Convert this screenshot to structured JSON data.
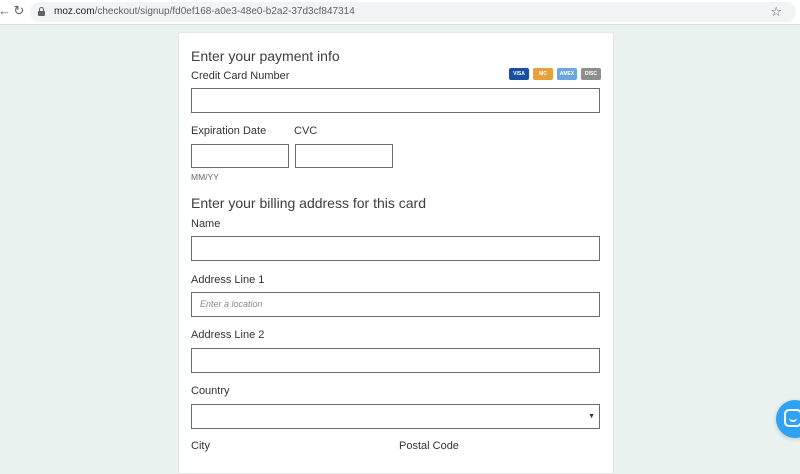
{
  "browser": {
    "url_host": "moz.com",
    "url_path": "/checkout/signup/fd0ef168-a0e3-48e0-b2a2-37d3cf847314",
    "back_icon": "arrow-back-icon",
    "reload_icon": "reload-icon",
    "lock_icon": "lock-icon",
    "bookmark_icon": "star-icon"
  },
  "payment": {
    "heading": "Enter your payment info",
    "card_number_label": "Credit Card Number",
    "card_number_value": "",
    "accepted_cards": [
      {
        "name": "VISA",
        "color": "#1a4fa0"
      },
      {
        "name": "MasterCard",
        "color": "#e8a03a"
      },
      {
        "name": "AMEX",
        "color": "#6aa6e0"
      },
      {
        "name": "DISCOVER",
        "color": "#8e8e8e"
      }
    ],
    "expiration_label": "Expiration Date",
    "expiration_value": "",
    "expiration_hint": "MM/YY",
    "cvc_label": "CVC",
    "cvc_value": ""
  },
  "billing": {
    "heading": "Enter your billing address for this card",
    "name_label": "Name",
    "name_value": "",
    "address1_label": "Address Line 1",
    "address1_placeholder": "Enter a location",
    "address2_label": "Address Line 2",
    "address2_value": "",
    "country_label": "Country",
    "country_selected": "",
    "city_label": "City",
    "postal_label": "Postal Code"
  },
  "chat": {
    "icon": "chat-bubble-icon",
    "color": "#2ea3f2"
  }
}
